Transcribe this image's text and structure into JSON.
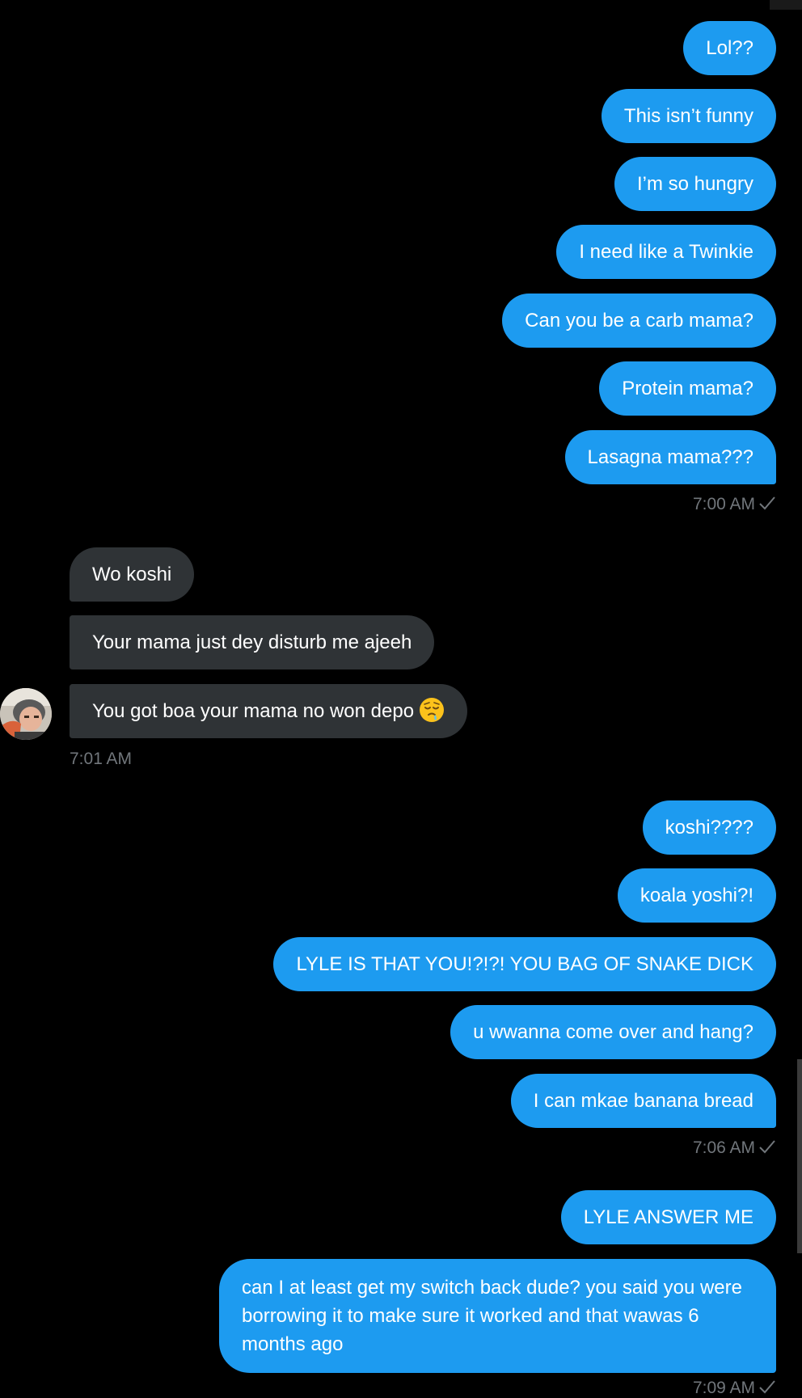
{
  "messages": {
    "group1": [
      "Lol??",
      "This isn’t funny",
      "I’m so hungry",
      "I need like a Twinkie",
      "Can you be a carb mama?",
      "Protein mama?",
      "Lasagna mama???"
    ],
    "group1_time": "7:00 AM",
    "received": [
      "Wo koshi",
      "Your mama just dey disturb me ajeeh",
      "You got boa your mama no won depo"
    ],
    "received_time": "7:01 AM",
    "group2": [
      "koshi????",
      "koala yoshi?!",
      "LYLE IS THAT YOU!?!?! YOU BAG OF SNAKE DICK",
      "u wwanna come over and hang?",
      "I can mkae banana bread"
    ],
    "group2_time": "7:06 AM",
    "group3": [
      "LYLE ANSWER ME",
      "can I at least get my switch back dude? you said you were borrowing it to make sure it worked and that wawas 6 months ago"
    ],
    "group3_time": "7:09 AM"
  },
  "icons": {
    "avatar": "contact-avatar",
    "sent_indicator": "checkmark-icon",
    "emoji": "drooling-sleepy-face-emoji"
  },
  "colors": {
    "sent_bubble": "#1d9bf0",
    "received_bubble": "#2f3336",
    "timestamp": "#71767b",
    "background": "#000000"
  }
}
